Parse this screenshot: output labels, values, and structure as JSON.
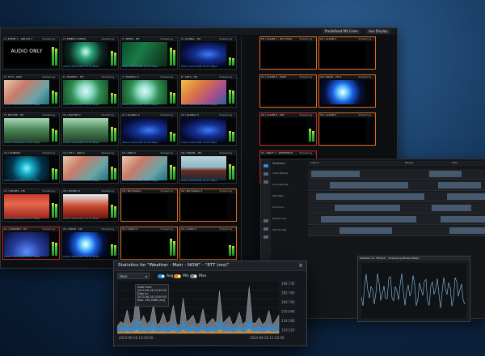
{
  "multiviewer": {
    "toolbar": {
      "btn1": "Predefined MV Lines",
      "btn2": "Aux Display"
    },
    "tiles": [
      {
        "name": "1 / EVENT 1 - ABC/CH 1",
        "status": "Streaming",
        "thumb": "t-audio",
        "audio_text": "AUDIO ONLY",
        "meter": [
          90,
          80
        ],
        "foot": ""
      },
      {
        "name": "2 / EMBED (VIDEO)",
        "status": "Streaming",
        "thumb": "t-stage",
        "meter": [
          70,
          60
        ],
        "foot": "H264 1920x1080 29.97 Mbps"
      },
      {
        "name": "3 / NEWS - HD",
        "status": "Streaming",
        "thumb": "t-news",
        "meter": [
          85,
          75
        ],
        "foot": "H264 1920x1080 29.97 Mbps"
      },
      {
        "name": "4 / GLOBAL - HD",
        "status": "Streaming",
        "thumb": "t-blue",
        "meter": [
          40,
          35
        ],
        "foot": "H264 1920x1080 29.97 Mbps"
      },
      {
        "name": "5 / CH 5 - KIDS",
        "status": "Streaming",
        "thumb": "t-child",
        "meter": [
          60,
          55
        ],
        "foot": "H264 1920x1080 29.97 Mbps"
      },
      {
        "name": "6 / FANTASY - HD",
        "status": "Streaming",
        "thumb": "t-wings",
        "meter": [
          50,
          45
        ],
        "foot": "H264 1920x1080 29.97 Mbps"
      },
      {
        "name": "7 / FANTASY 2",
        "status": "Streaming",
        "thumb": "t-wings",
        "meter": [
          55,
          50
        ],
        "foot": "H264 1920x1080 29.97 Mbps"
      },
      {
        "name": "8 / ARTS - HD",
        "status": "Streaming",
        "thumb": "t-paint",
        "meter": [
          65,
          60
        ],
        "foot": "H264 1920x1080 29.97 Mbps"
      },
      {
        "name": "9 / NATURE - HD",
        "status": "Streaming",
        "thumb": "t-jungle",
        "meter": [
          60,
          55
        ],
        "foot": "H264 1920x1080 29.97 Mbps"
      },
      {
        "name": "10 / NATURE 2",
        "status": "Streaming",
        "thumb": "t-jungle",
        "meter": [
          70,
          65
        ],
        "foot": "H264 1920x1080 29.97 Mbps"
      },
      {
        "name": "11 / GLOBAL 2",
        "status": "Streaming",
        "thumb": "t-blue",
        "meter": [
          45,
          40
        ],
        "foot": "H264 1920x1080 29.97 Mbps"
      },
      {
        "name": "12 / GLOBAL 3",
        "status": "Streaming",
        "thumb": "t-blue",
        "meter": [
          50,
          45
        ],
        "foot": "H264 1920x1080 29.97 Mbps"
      },
      {
        "name": "13 / SCIENCE",
        "status": "Streaming",
        "thumb": "t-cyan",
        "meter": [
          55,
          50
        ],
        "foot": "H264 1920x1080 29.97 Mbps"
      },
      {
        "name": "14 / CH 5 - KIDS 2",
        "status": "Streaming",
        "thumb": "t-child",
        "meter": [
          60,
          55
        ],
        "foot": "H264 1920x1080 29.97 Mbps"
      },
      {
        "name": "15 / KIDS 3",
        "status": "Streaming",
        "thumb": "t-child",
        "meter": [
          70,
          60
        ],
        "foot": "H264 1920x1080 29.97 Mbps"
      },
      {
        "name": "16 / TRAVEL - HD",
        "status": "Streaming",
        "thumb": "t-boat",
        "meter": [
          75,
          65
        ],
        "foot": "H264 1920x1080 29.97 Mbps"
      },
      {
        "name": "17 / SPORTS - HD",
        "status": "Streaming",
        "thumb": "t-crowd",
        "meter": [
          70,
          65
        ],
        "foot": "H264 1920x1080 29.97 Mbps"
      },
      {
        "name": "18 / SPORTS 2",
        "status": "Streaming",
        "thumb": "t-crowd2",
        "meter": [
          60,
          55
        ],
        "foot": "H264 1920x1080 29.97 Mbps"
      },
      {
        "name": "19 / NO SIGNAL",
        "status": "Streaming",
        "thumb": "t-black",
        "meter": [
          0,
          0
        ],
        "foot": "",
        "alert": "alert"
      },
      {
        "name": "20 / NO SIGNAL 2",
        "status": "Streaming",
        "thumb": "t-black",
        "meter": [
          0,
          0
        ],
        "foot": "",
        "alert": "alert"
      },
      {
        "name": "21 / CONCERT - HD",
        "status": "Streaming",
        "thumb": "t-concert",
        "meter": [
          65,
          60
        ],
        "foot": "H264 1920x1080 29.97 Mbps",
        "alert": "alert-red"
      },
      {
        "name": "22 / SPACE - HD",
        "status": "Streaming",
        "thumb": "t-globe",
        "meter": [
          55,
          50
        ],
        "foot": "H264 1920x1080 29.97 Mbps"
      },
      {
        "name": "23 / AUDIO 3",
        "status": "Streaming",
        "thumb": "t-black",
        "meter": [
          80,
          70
        ],
        "foot": "",
        "alert": "alert"
      },
      {
        "name": "24 / AUDIO 4",
        "status": "Streaming",
        "thumb": "t-black",
        "meter": [
          50,
          45
        ],
        "foot": "",
        "alert": "alert"
      }
    ],
    "alarm_tiles": [
      {
        "name": "25 / ALARM 1 - NOT AVAIL",
        "status": "Streaming",
        "thumb": "t-black",
        "meter": [
          0,
          0
        ],
        "alert": "alert"
      },
      {
        "name": "26 / ALARM 2",
        "status": "Streaming",
        "thumb": "t-black",
        "meter": [
          0,
          0
        ],
        "alert": "alert"
      },
      {
        "name": "27 / ALARM 3 - MIXD",
        "status": "Streaming",
        "thumb": "t-black",
        "meter": [
          0,
          0
        ],
        "alert": "alert"
      },
      {
        "name": "28 / SPACE - HD 2",
        "status": "Streaming",
        "thumb": "t-globe",
        "meter": [
          0,
          0
        ],
        "alert": "alert"
      },
      {
        "name": "29 / ALARM 5 - MIX",
        "status": "Streaming",
        "thumb": "t-black",
        "meter": [
          60,
          50
        ],
        "alert": "alert-red"
      },
      {
        "name": "30 / ALARM 6",
        "status": "Streaming",
        "thumb": "t-black",
        "meter": [
          0,
          0
        ],
        "alert": "alert"
      },
      {
        "name": "31 / INPUT 7 - REFERENCE",
        "status": "Streaming",
        "thumb": "t-black",
        "meter": [
          0,
          0
        ],
        "alert": "alert-red"
      }
    ]
  },
  "graphs": {
    "header": "Statistics",
    "columns": [
      "Metric",
      "Bitrate",
      "Rate"
    ],
    "rows": [
      "Video Bitrate",
      "Audio Bitrate",
      "PCR Jitter",
      "CC Errors",
      "Packet Loss",
      "TR 101 290"
    ],
    "mini_title": "Statistics for \"Bitrate\" - Streaming Bitrate (Mbps)"
  },
  "stats_dialog": {
    "title": "Statistics for \"Weather - Main - NOW\" - \"RTT (ms)\"",
    "close": "×",
    "range": "Hour",
    "toggles": [
      {
        "label": "Avg",
        "color": "#2f8bd6"
      },
      {
        "label": "Min",
        "color": "#e08a24"
      },
      {
        "label": "Max",
        "color": "#7c8590"
      }
    ],
    "legend": {
      "date_from_label": "Date from:",
      "date_from": "2023-06-26 10:49:53",
      "date_to_label": "Date to:",
      "date_to": "2023-06-26 10:50:53",
      "max_label": "Max:",
      "max_value": "194,5466 [ms]"
    },
    "x_start": "2023-06-26 10:50:00",
    "x_end": "2023-06-26 11:50:00"
  },
  "chart_data": {
    "type": "area",
    "title": "Statistics for \"Weather - Main - NOW\" - \"RTT (ms)\"",
    "xlabel": "",
    "ylabel": "",
    "y_ticks": [
      "194.745",
      "182.760",
      "166.700",
      "150.640",
      "134.580",
      "118.520"
    ],
    "ylim": [
      110,
      198
    ],
    "series": [
      {
        "name": "Max",
        "values": [
          122,
          130,
          127,
          150,
          125,
          135,
          188,
          128,
          140,
          126,
          132,
          160,
          124,
          129,
          145,
          127,
          131,
          158,
          126,
          123,
          170,
          129,
          134,
          141,
          125,
          128,
          152,
          124,
          130,
          136,
          126,
          182,
          127,
          133,
          139,
          124,
          129,
          146,
          125,
          131,
          190,
          127,
          128,
          137,
          125,
          130,
          149,
          124,
          132,
          141
        ]
      },
      {
        "name": "Avg",
        "values": [
          118,
          121,
          119,
          126,
          118,
          122,
          134,
          120,
          124,
          119,
          121,
          129,
          118,
          120,
          125,
          119,
          121,
          128,
          119,
          118,
          131,
          120,
          122,
          124,
          119,
          120,
          127,
          118,
          121,
          123,
          119,
          133,
          120,
          122,
          124,
          118,
          120,
          125,
          119,
          121,
          136,
          120,
          120,
          123,
          119,
          121,
          126,
          118,
          121,
          124
        ]
      },
      {
        "name": "Min",
        "values": [
          112,
          113,
          112,
          114,
          112,
          113,
          116,
          112,
          114,
          112,
          113,
          115,
          112,
          113,
          114,
          112,
          113,
          115,
          112,
          112,
          116,
          113,
          113,
          114,
          112,
          113,
          115,
          112,
          113,
          114,
          112,
          117,
          113,
          113,
          114,
          112,
          113,
          115,
          112,
          113,
          118,
          113,
          113,
          114,
          112,
          113,
          115,
          112,
          113,
          114
        ]
      }
    ]
  },
  "colors": {
    "accent": "#2f8bd6",
    "warning": "#e06a20",
    "error": "#c62828",
    "min": "#e08a24",
    "max": "#b0b7bf"
  }
}
